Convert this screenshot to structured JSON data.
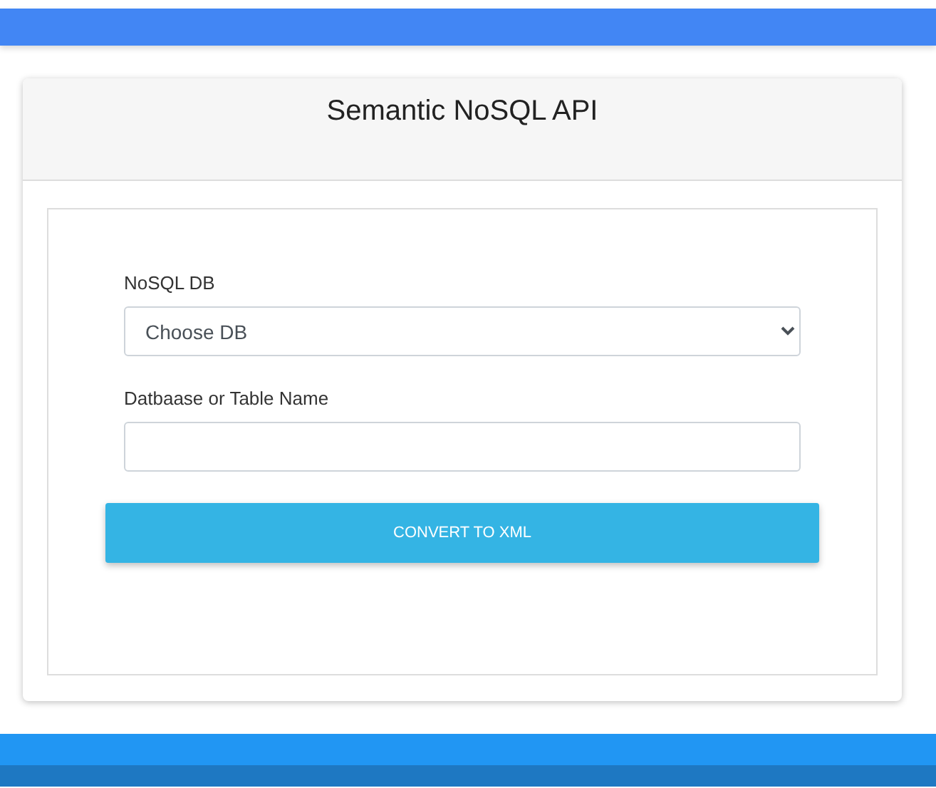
{
  "card": {
    "title": "Semantic NoSQL API"
  },
  "form": {
    "fields": [
      {
        "kind": "select",
        "label": "NoSQL DB",
        "value": "Choose DB"
      },
      {
        "kind": "text",
        "label": "Datbaase or Table Name"
      }
    ],
    "submit": "CONVERT TO XML"
  }
}
